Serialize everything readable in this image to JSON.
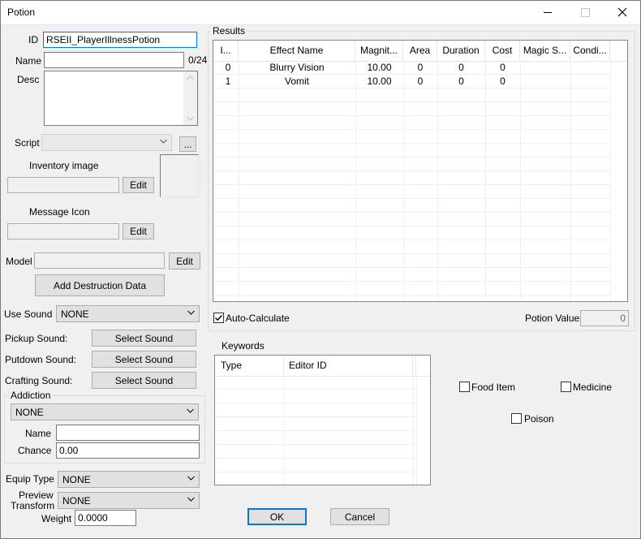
{
  "window": {
    "title": "Potion"
  },
  "left": {
    "id_label": "ID",
    "id_value": "RSEII_PlayerIllnessPotion",
    "name_label": "Name",
    "name_value": "",
    "name_counter": "0/24",
    "desc_label": "Desc",
    "script_label": "Script",
    "script_button": "...",
    "inventory_image_label": "Inventory image",
    "inventory_edit": "Edit",
    "message_icon_label": "Message Icon",
    "message_edit": "Edit",
    "model_label": "Model",
    "model_edit": "Edit",
    "add_destruction": "Add Destruction Data",
    "use_sound_label": "Use Sound",
    "use_sound_value": "NONE",
    "pickup_sound_label": "Pickup Sound:",
    "pickup_sound_button": "Select Sound",
    "putdown_sound_label": "Putdown Sound:",
    "putdown_sound_button": "Select Sound",
    "crafting_sound_label": "Crafting Sound:",
    "crafting_sound_button": "Select Sound",
    "addiction_group": "Addiction",
    "addiction_value": "NONE",
    "addiction_name_label": "Name",
    "addiction_name_value": "",
    "addiction_chance_label": "Chance",
    "addiction_chance_value": "0.00",
    "equip_type_label": "Equip Type",
    "equip_type_value": "NONE",
    "preview_transform_label_1": "Preview",
    "preview_transform_label_2": "Transform",
    "preview_transform_value": "NONE",
    "weight_label": "Weight",
    "weight_value": "0.0000"
  },
  "results": {
    "group_title": "Results",
    "columns": [
      "I...",
      "Effect Name",
      "Magnit...",
      "Area",
      "Duration",
      "Cost",
      "Magic S...",
      "Condi..."
    ],
    "rows": [
      [
        "0",
        "Blurry Vision",
        "10.00",
        "0",
        "0",
        "0",
        "",
        ""
      ],
      [
        "1",
        "Vomit",
        "10.00",
        "0",
        "0",
        "0",
        "",
        ""
      ]
    ],
    "auto_calculate_label": "Auto-Calculate",
    "auto_calculate_checked": true,
    "potion_value_label": "Potion Value",
    "potion_value": "0"
  },
  "keywords": {
    "group_title": "Keywords",
    "columns": [
      "Type",
      "Editor ID"
    ]
  },
  "flags": {
    "food_item": "Food Item",
    "medicine": "Medicine",
    "poison": "Poison"
  },
  "footer": {
    "ok": "OK",
    "cancel": "Cancel"
  },
  "colors": {
    "focus_border": "#0078d7",
    "ok_border": "#0078d7"
  }
}
